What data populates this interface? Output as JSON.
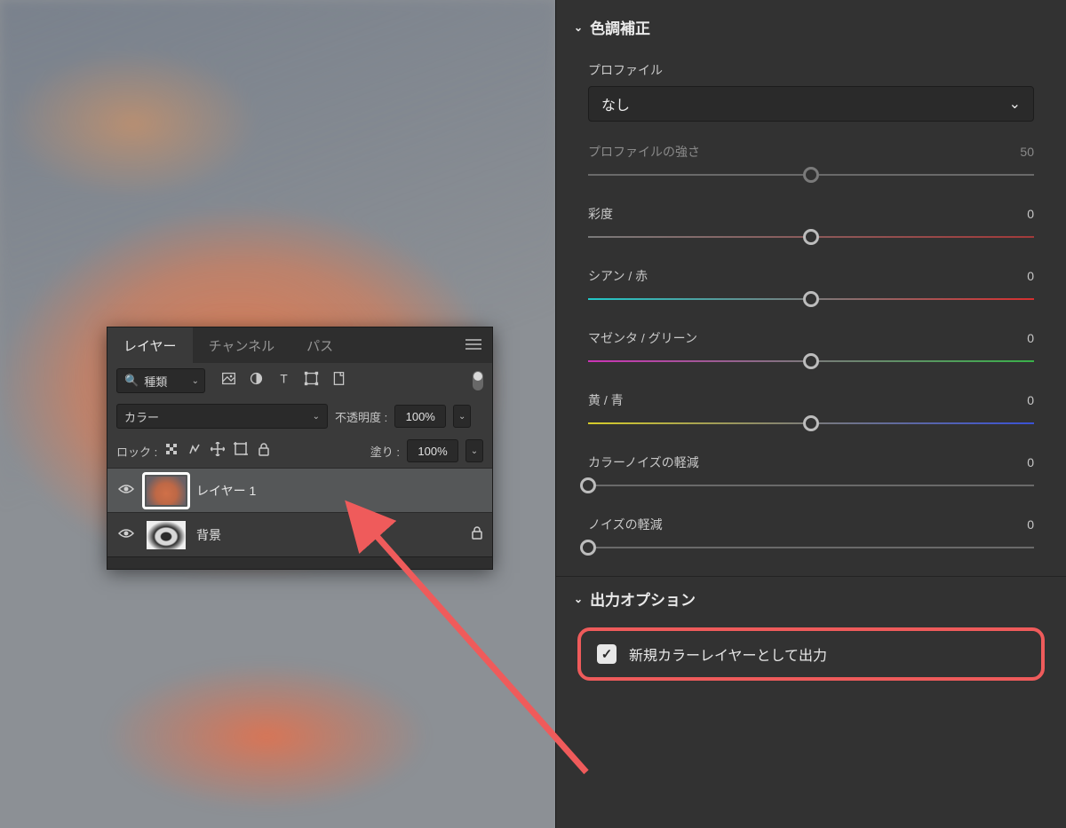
{
  "layers_panel": {
    "tabs": {
      "layers": "レイヤー",
      "channels": "チャンネル",
      "paths": "パス"
    },
    "filter": {
      "label": "種類"
    },
    "blend_mode": {
      "value": "カラー"
    },
    "opacity": {
      "label": "不透明度 :",
      "value": "100%"
    },
    "lock_label": "ロック :",
    "fill": {
      "label": "塗り :",
      "value": "100%"
    },
    "items": [
      {
        "name": "レイヤー 1",
        "selected": true,
        "locked": false
      },
      {
        "name": "背景",
        "selected": false,
        "locked": true
      }
    ]
  },
  "sidebar": {
    "color_section": {
      "title": "色調補正",
      "profile_label": "プロファイル",
      "profile_value": "なし",
      "profile_strength": {
        "label": "プロファイルの強さ",
        "value": "50",
        "pos": 50,
        "disabled": true
      },
      "sliders": [
        {
          "key": "saturation",
          "label": "彩度",
          "value": "0",
          "pos": 50,
          "grad": "grad-sat"
        },
        {
          "key": "cyan_red",
          "label": "シアン / 赤",
          "value": "0",
          "pos": 50,
          "grad": "grad-cr"
        },
        {
          "key": "magenta_green",
          "label": "マゼンタ / グリーン",
          "value": "0",
          "pos": 50,
          "grad": "grad-mg"
        },
        {
          "key": "yellow_blue",
          "label": "黄 / 青",
          "value": "0",
          "pos": 50,
          "grad": "grad-yb"
        },
        {
          "key": "color_noise",
          "label": "カラーノイズの軽減",
          "value": "0",
          "pos": 0,
          "grad": "plain"
        },
        {
          "key": "noise",
          "label": "ノイズの軽減",
          "value": "0",
          "pos": 0,
          "grad": "plain"
        }
      ]
    },
    "output_section": {
      "title": "出力オプション",
      "checkbox_label": "新規カラーレイヤーとして出力",
      "checked": true
    }
  }
}
